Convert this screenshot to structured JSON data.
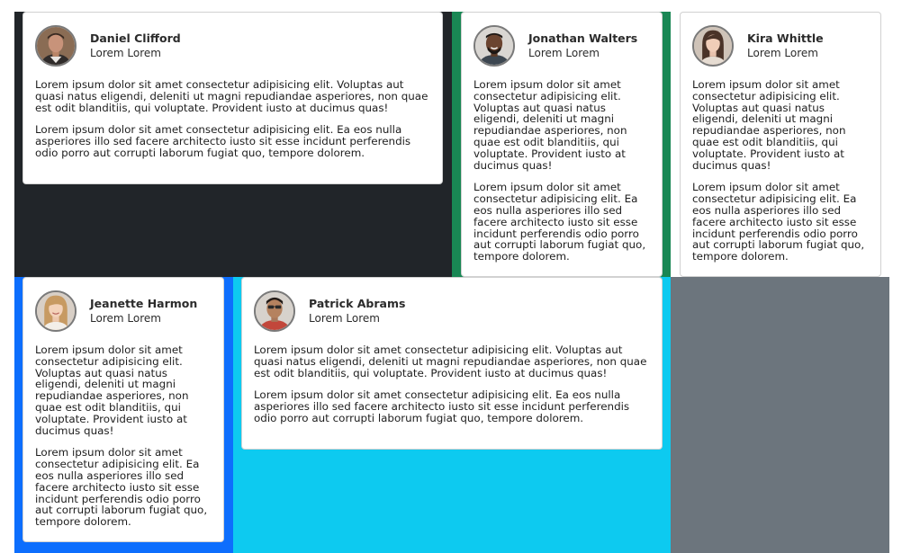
{
  "colors": {
    "panel_dark": "#212529",
    "panel_green": "#198754",
    "panel_blue": "#0d6efd",
    "panel_cyan": "#0dcaf0",
    "panel_gray": "#6c757d"
  },
  "testimonials": [
    {
      "name": "Daniel Clifford",
      "role": "Lorem Lorem",
      "avatar_icon": "man-portrait-icon",
      "paragraphs": [
        "Lorem ipsum dolor sit amet consectetur adipisicing elit. Voluptas aut quasi natus eligendi, deleniti ut magni repudiandae asperiores, non quae est odit blanditiis, qui voluptate. Provident iusto at ducimus quas!",
        "Lorem ipsum dolor sit amet consectetur adipisicing elit. Ea eos nulla asperiores illo sed facere architecto iusto sit esse incidunt perferendis odio porro aut corrupti laborum fugiat quo, tempore dolorem."
      ]
    },
    {
      "name": "Jonathan Walters",
      "role": "Lorem Lorem",
      "avatar_icon": "man-portrait-icon",
      "paragraphs": [
        "Lorem ipsum dolor sit amet consectetur adipisicing elit. Voluptas aut quasi natus eligendi, deleniti ut magni repudiandae asperiores, non quae est odit blanditiis, qui voluptate. Provident iusto at ducimus quas!",
        "Lorem ipsum dolor sit amet consectetur adipisicing elit. Ea eos nulla asperiores illo sed facere architecto iusto sit esse incidunt perferendis odio porro aut corrupti laborum fugiat quo, tempore dolorem."
      ]
    },
    {
      "name": "Kira Whittle",
      "role": "Lorem Lorem",
      "avatar_icon": "woman-portrait-icon",
      "paragraphs": [
        "Lorem ipsum dolor sit amet consectetur adipisicing elit. Voluptas aut quasi natus eligendi, deleniti ut magni repudiandae asperiores, non quae est odit blanditiis, qui voluptate. Provident iusto at ducimus quas!",
        "Lorem ipsum dolor sit amet consectetur adipisicing elit. Ea eos nulla asperiores illo sed facere architecto iusto sit esse incidunt perferendis odio porro aut corrupti laborum fugiat quo, tempore dolorem."
      ]
    },
    {
      "name": "Jeanette Harmon",
      "role": "Lorem Lorem",
      "avatar_icon": "woman-portrait-icon",
      "paragraphs": [
        "Lorem ipsum dolor sit amet consectetur adipisicing elit. Voluptas aut quasi natus eligendi, deleniti ut magni repudiandae asperiores, non quae est odit blanditiis, qui voluptate. Provident iusto at ducimus quas!",
        "Lorem ipsum dolor sit amet consectetur adipisicing elit. Ea eos nulla asperiores illo sed facere architecto iusto sit esse incidunt perferendis odio porro aut corrupti laborum fugiat quo, tempore dolorem."
      ]
    },
    {
      "name": "Patrick Abrams",
      "role": "Lorem Lorem",
      "avatar_icon": "man-portrait-icon",
      "paragraphs": [
        "Lorem ipsum dolor sit amet consectetur adipisicing elit. Voluptas aut quasi natus eligendi, deleniti ut magni repudiandae asperiores, non quae est odit blanditiis, qui voluptate. Provident iusto at ducimus quas!",
        "Lorem ipsum dolor sit amet consectetur adipisicing elit. Ea eos nulla asperiores illo sed facere architecto iusto sit esse incidunt perferendis odio porro aut corrupti laborum fugiat quo, tempore dolorem."
      ]
    }
  ]
}
